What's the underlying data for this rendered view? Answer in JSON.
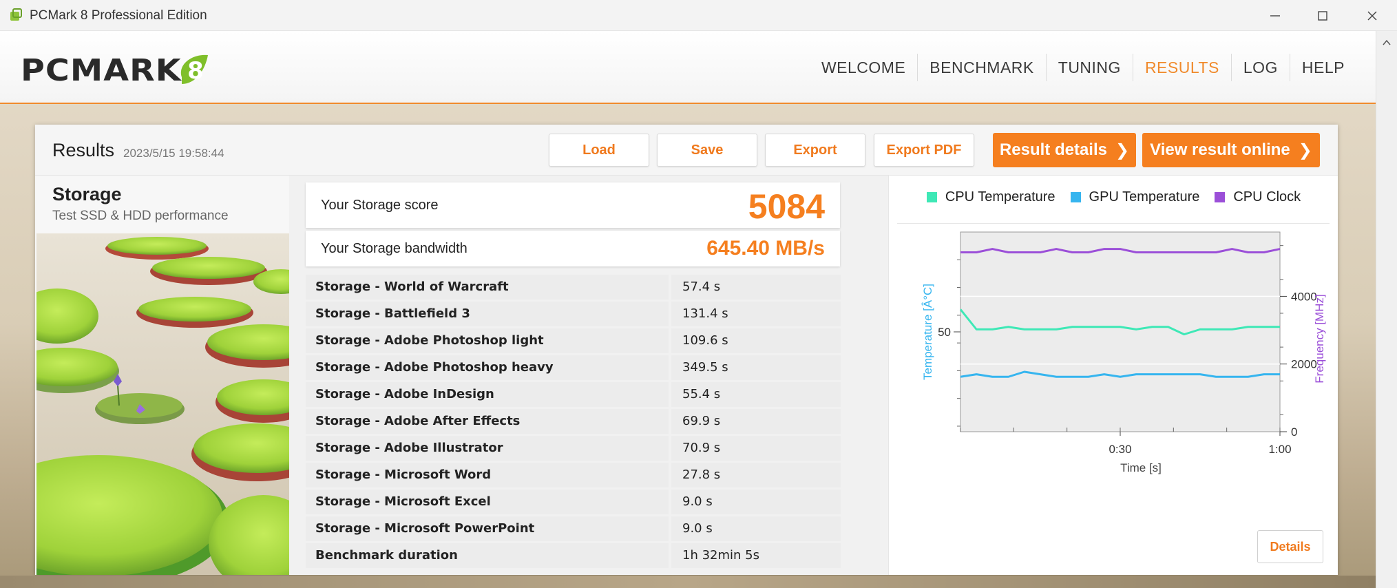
{
  "window": {
    "title": "PCMark 8 Professional Edition"
  },
  "logo": {
    "text": "PCMARK",
    "version": "8"
  },
  "nav": {
    "items": [
      {
        "label": "WELCOME",
        "active": false
      },
      {
        "label": "BENCHMARK",
        "active": false
      },
      {
        "label": "TUNING",
        "active": false
      },
      {
        "label": "RESULTS",
        "active": true
      },
      {
        "label": "LOG",
        "active": false
      },
      {
        "label": "HELP",
        "active": false
      }
    ]
  },
  "results": {
    "title": "Results",
    "date": "2023/5/15 19:58:44",
    "buttons": {
      "load": "Load",
      "save": "Save",
      "export": "Export",
      "export_pdf": "Export PDF",
      "result_details": "Result details",
      "view_online": "View result online"
    }
  },
  "test": {
    "name": "Storage",
    "description": "Test SSD & HDD performance"
  },
  "score": {
    "label": "Your Storage score",
    "value": "5084",
    "bandwidth_label": "Your Storage bandwidth",
    "bandwidth_value": "645.40 MB/s"
  },
  "rows": [
    {
      "name": "Storage - World of Warcraft",
      "value": "57.4 s"
    },
    {
      "name": "Storage - Battlefield 3",
      "value": "131.4 s"
    },
    {
      "name": "Storage - Adobe Photoshop light",
      "value": "109.6 s"
    },
    {
      "name": "Storage - Adobe Photoshop heavy",
      "value": "349.5 s"
    },
    {
      "name": "Storage - Adobe InDesign",
      "value": "55.4 s"
    },
    {
      "name": "Storage - Adobe After Effects",
      "value": "69.9 s"
    },
    {
      "name": "Storage - Adobe Illustrator",
      "value": "70.9 s"
    },
    {
      "name": "Storage - Microsoft Word",
      "value": "27.8 s"
    },
    {
      "name": "Storage - Microsoft Excel",
      "value": "9.0 s"
    },
    {
      "name": "Storage - Microsoft PowerPoint",
      "value": "9.0 s"
    },
    {
      "name": "Benchmark duration",
      "value": "1h 32min 5s"
    }
  ],
  "details_button": "Details",
  "chart_data": {
    "type": "line",
    "legend_position": "top",
    "xlabel": "Time [s]",
    "ylabel_left": "Temperature [Â°C]",
    "ylabel_right": "Frequency [MHz]",
    "x_ticks": [
      {
        "value": 30,
        "label": "0:30"
      },
      {
        "value": 60,
        "label": "1:00"
      }
    ],
    "xlim": [
      0,
      60
    ],
    "ylim_left": [
      10,
      90
    ],
    "left_ticks": [
      {
        "value": 50,
        "label": "50"
      }
    ],
    "ylim_right": [
      0,
      5900
    ],
    "right_ticks": [
      {
        "value": 0,
        "label": "0"
      },
      {
        "value": 2000,
        "label": "2000"
      },
      {
        "value": 4000,
        "label": "4000"
      }
    ],
    "x": [
      0,
      3,
      6,
      9,
      12,
      15,
      18,
      21,
      24,
      27,
      30,
      33,
      36,
      39,
      42,
      45,
      48,
      51,
      54,
      57,
      60
    ],
    "series": [
      {
        "name": "CPU Temperature",
        "axis": "left",
        "color": "#3ee8b6",
        "values": [
          59,
          51,
          51,
          52,
          51,
          51,
          51,
          52,
          52,
          52,
          52,
          51,
          52,
          52,
          49,
          51,
          51,
          51,
          52,
          52,
          52
        ]
      },
      {
        "name": "GPU Temperature",
        "axis": "left",
        "color": "#36b5ef",
        "values": [
          32,
          33,
          32,
          32,
          34,
          33,
          32,
          32,
          32,
          33,
          32,
          33,
          33,
          33,
          33,
          33,
          32,
          32,
          32,
          33,
          33
        ]
      },
      {
        "name": "CPU Clock",
        "axis": "right",
        "color": "#9b4fd8",
        "values": [
          5300,
          5300,
          5400,
          5300,
          5300,
          5300,
          5400,
          5300,
          5300,
          5400,
          5400,
          5300,
          5300,
          5300,
          5300,
          5300,
          5300,
          5400,
          5300,
          5300,
          5400
        ]
      }
    ]
  }
}
